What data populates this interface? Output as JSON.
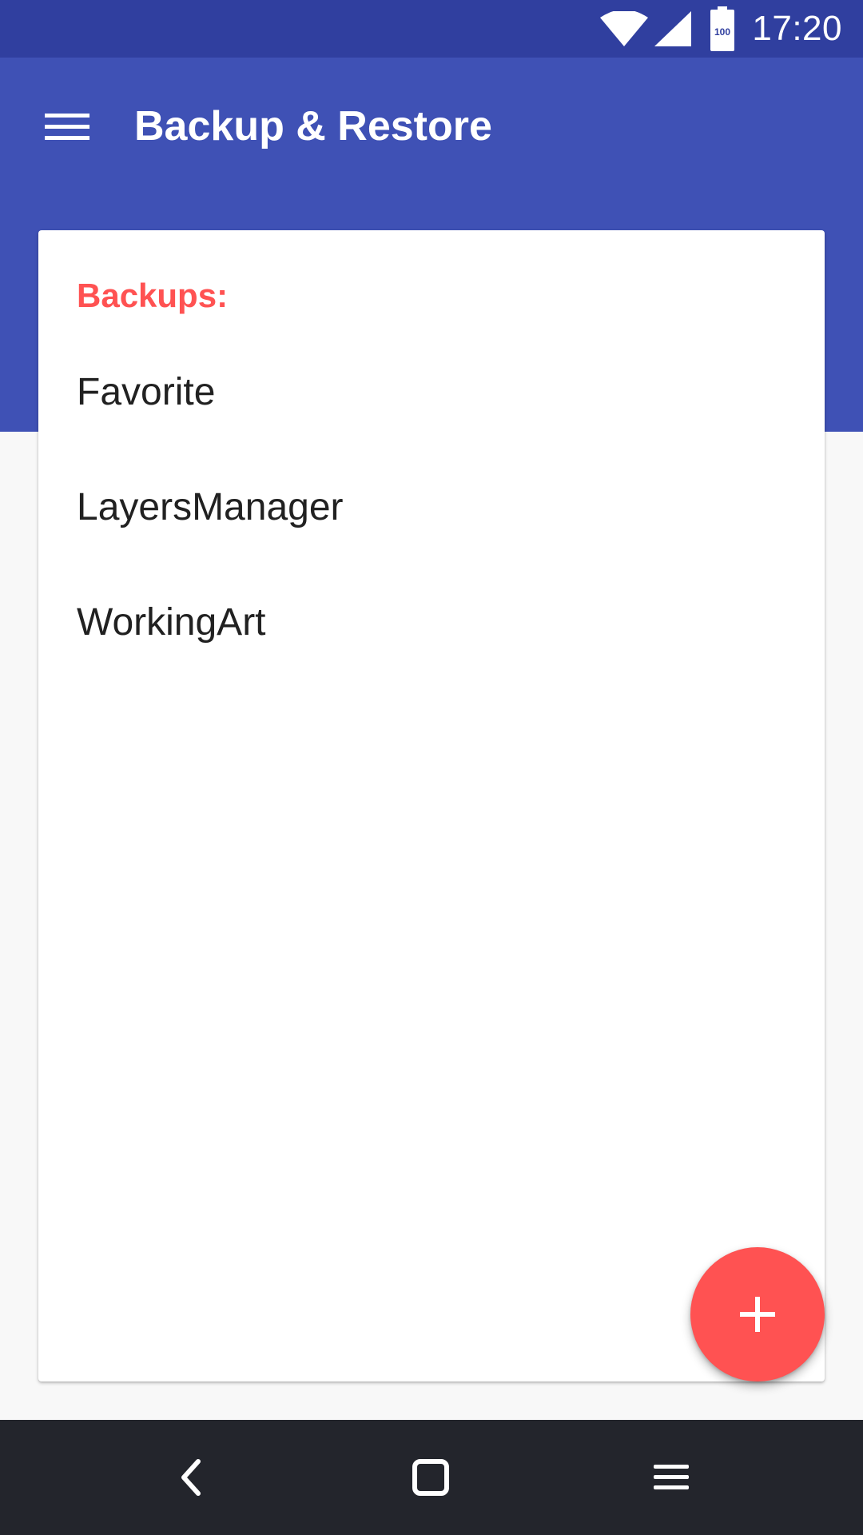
{
  "status_bar": {
    "time": "17:20",
    "battery_level": "100",
    "icons": [
      "wifi-icon",
      "signal-icon",
      "battery-icon"
    ]
  },
  "app_bar": {
    "title": "Backup & Restore",
    "menu_icon": "hamburger-menu-icon"
  },
  "card": {
    "header": "Backups:",
    "items": [
      {
        "label": "Favorite"
      },
      {
        "label": "LayersManager"
      },
      {
        "label": "WorkingArt"
      }
    ]
  },
  "fab": {
    "icon": "plus-icon"
  },
  "nav_bar": {
    "icons": [
      "back-icon",
      "home-icon",
      "menu-icon"
    ]
  },
  "colors": {
    "status_bar": "#303f9f",
    "app_bar": "#3f51b5",
    "accent": "#ff5252",
    "nav_bar": "#23252c"
  }
}
